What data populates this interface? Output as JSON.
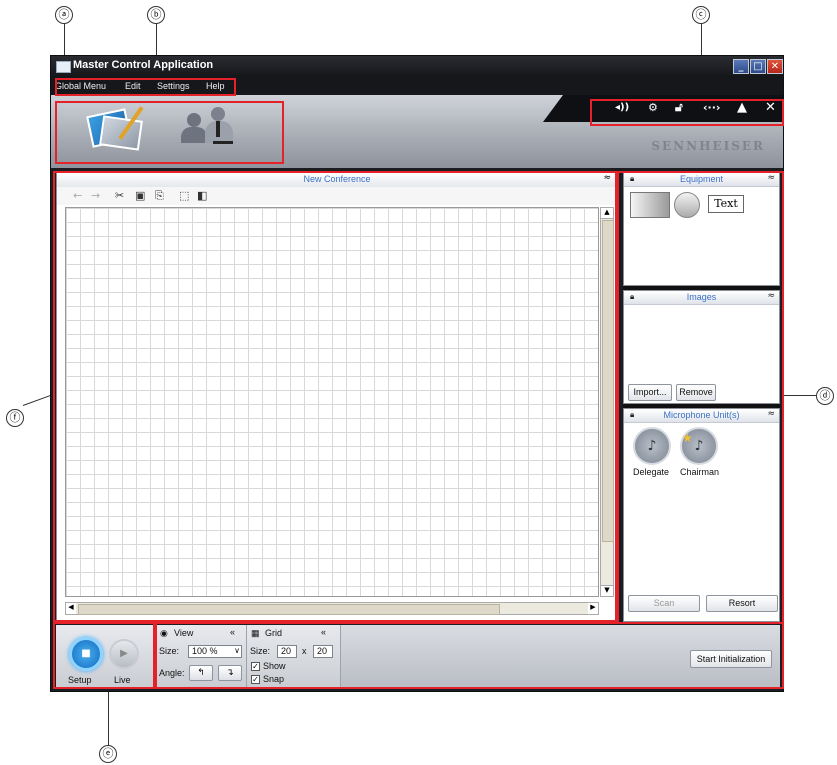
{
  "window": {
    "title": "Master Control Application"
  },
  "menu": [
    "Global Menu",
    "Edit",
    "Settings",
    "Help"
  ],
  "brand": "SENNHEISER",
  "callouts": {
    "a": "ⓐ",
    "b": "ⓑ",
    "c": "ⓒ",
    "d": "ⓓ",
    "e": "ⓔ",
    "f": "ⓕ"
  },
  "canvas": {
    "title": "New Conference"
  },
  "equipment": {
    "title": "Equipment",
    "text_item": "Text"
  },
  "images": {
    "title": "Images",
    "import_label": "Import...",
    "remove_label": "Remove"
  },
  "microphones": {
    "title": "Microphone Unit(s)",
    "delegate": "Delegate",
    "chairman": "Chairman",
    "scan_label": "Scan",
    "resort_label": "Resort"
  },
  "mode": {
    "setup": "Setup",
    "live": "Live"
  },
  "view": {
    "title": "View",
    "size_label": "Size:",
    "size_value": "100 %",
    "angle_label": "Angle:"
  },
  "grid": {
    "title": "Grid",
    "size_label": "Size:",
    "width": "20",
    "x": "x",
    "height": "20",
    "show": "Show",
    "snap": "Snap"
  },
  "start_button": "Start Initialization"
}
